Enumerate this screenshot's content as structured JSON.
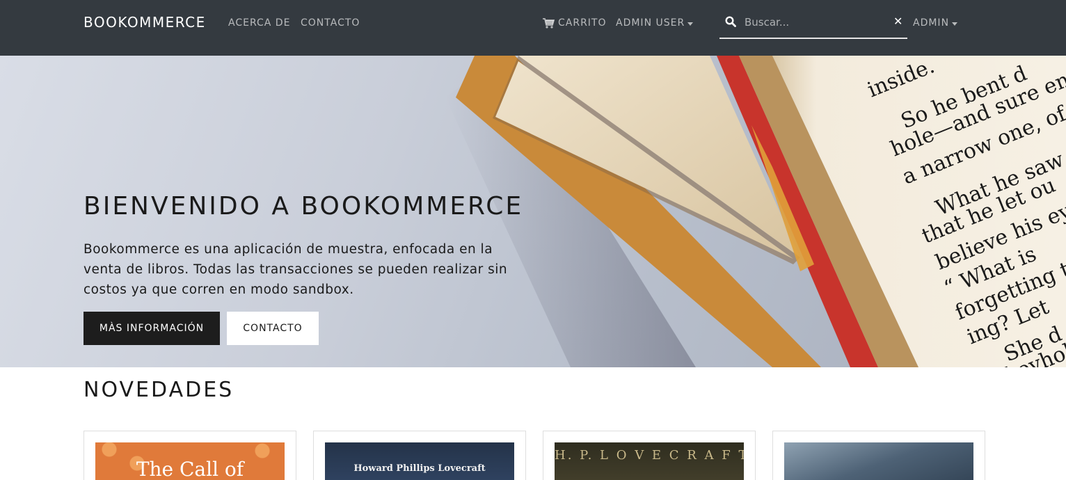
{
  "navbar": {
    "brand": "BOOKOMMERCE",
    "links": {
      "about": "ACERCA DE",
      "contact": "CONTACTO"
    },
    "cart_label": "CARRITO",
    "user_label": "ADMIN USER",
    "admin_label": "ADMIN",
    "search": {
      "placeholder": "Buscar...",
      "value": ""
    },
    "icons": {
      "cart": "cart-icon",
      "search": "search-icon",
      "clear": "close-icon"
    }
  },
  "hero": {
    "title": "BIENVENIDO A BOOKOMMERCE",
    "description": "Bookommerce es una aplicación de muestra, enfocada en la venta de libros. Todas las transacciones se pueden realizar sin costos ya que corren en modo sandbox.",
    "primary_button": "MÀS INFORMACIÓN",
    "secondary_button": "CONTACTO",
    "book_page_lines": [
      "inside.",
      "So he bent d",
      "hole—and sure en",
      "a narrow one, of",
      "What he saw",
      "that he let ou",
      "believe his ey",
      "“ What is",
      "forgetting t",
      "ing? Let",
      "She d",
      "keyhole"
    ]
  },
  "novedades": {
    "title": "NOVEDADES",
    "books": [
      {
        "cover_text": "The Call of",
        "color": "#e07a3a"
      },
      {
        "cover_text": "Howard Phillips Lovecraft",
        "color": "#2b3b55"
      },
      {
        "cover_text": "H. P. L O V E C R A F T",
        "color": "#3d3a28"
      },
      {
        "cover_text": "",
        "color": "#5a6d80"
      }
    ]
  },
  "colors": {
    "navbar": "#343a40",
    "dark_button": "#1d1d1d",
    "accent_red": "#c8342c",
    "accent_yellow": "#e0a03a"
  }
}
